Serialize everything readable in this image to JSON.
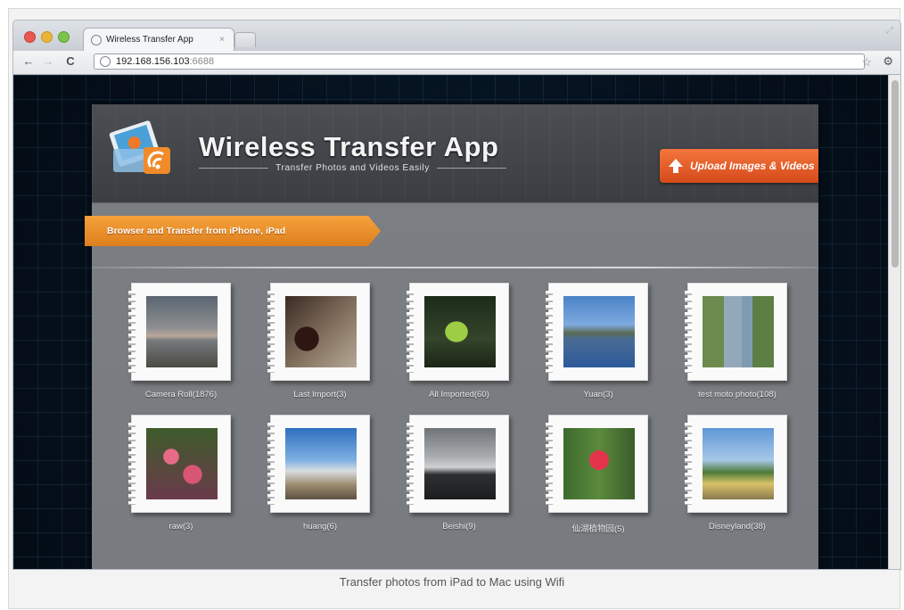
{
  "browser": {
    "tab_title": "Wireless Transfer App",
    "tab_close": "×",
    "url_host": "192.168.156.103",
    "url_port": ":6688",
    "back_icon": "←",
    "forward_icon": "→",
    "reload_icon": "C",
    "star_icon": "☆",
    "wrench_icon": "🔧"
  },
  "app": {
    "title": "Wireless Transfer App",
    "subtitle": "Transfer Photos and Videos Easily",
    "upload_label": "Upload Images & Videos",
    "ribbon_label": "Browser and Transfer from iPhone,  iPad"
  },
  "albums": [
    {
      "label": "Camera Roll(1876)"
    },
    {
      "label": "Last Import(3)"
    },
    {
      "label": "All Imported(60)"
    },
    {
      "label": "Yuan(3)"
    },
    {
      "label": "test moto photo(108)"
    },
    {
      "label": "raw(3)"
    },
    {
      "label": "huang(6)"
    },
    {
      "label": "Beishi(9)"
    },
    {
      "label": "仙湖植物园(5)"
    },
    {
      "label": "Disneyland(38)"
    }
  ],
  "caption": "Transfer photos from iPad to Mac using Wifi",
  "colors": {
    "accent_orange": "#e2561f",
    "ribbon_orange": "#e98a27",
    "panel_gray": "#787b80",
    "page_bg": "#06121f"
  }
}
